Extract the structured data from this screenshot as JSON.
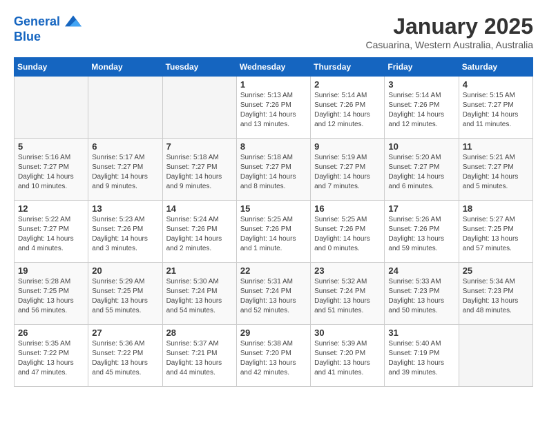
{
  "header": {
    "logo_line1": "General",
    "logo_line2": "Blue",
    "month_title": "January 2025",
    "location": "Casuarina, Western Australia, Australia"
  },
  "days_of_week": [
    "Sunday",
    "Monday",
    "Tuesday",
    "Wednesday",
    "Thursday",
    "Friday",
    "Saturday"
  ],
  "weeks": [
    {
      "days": [
        {
          "num": "",
          "sunrise": "",
          "sunset": "",
          "daylight": ""
        },
        {
          "num": "",
          "sunrise": "",
          "sunset": "",
          "daylight": ""
        },
        {
          "num": "",
          "sunrise": "",
          "sunset": "",
          "daylight": ""
        },
        {
          "num": "1",
          "sunrise": "Sunrise: 5:13 AM",
          "sunset": "Sunset: 7:26 PM",
          "daylight": "Daylight: 14 hours and 13 minutes."
        },
        {
          "num": "2",
          "sunrise": "Sunrise: 5:14 AM",
          "sunset": "Sunset: 7:26 PM",
          "daylight": "Daylight: 14 hours and 12 minutes."
        },
        {
          "num": "3",
          "sunrise": "Sunrise: 5:14 AM",
          "sunset": "Sunset: 7:26 PM",
          "daylight": "Daylight: 14 hours and 12 minutes."
        },
        {
          "num": "4",
          "sunrise": "Sunrise: 5:15 AM",
          "sunset": "Sunset: 7:27 PM",
          "daylight": "Daylight: 14 hours and 11 minutes."
        }
      ]
    },
    {
      "days": [
        {
          "num": "5",
          "sunrise": "Sunrise: 5:16 AM",
          "sunset": "Sunset: 7:27 PM",
          "daylight": "Daylight: 14 hours and 10 minutes."
        },
        {
          "num": "6",
          "sunrise": "Sunrise: 5:17 AM",
          "sunset": "Sunset: 7:27 PM",
          "daylight": "Daylight: 14 hours and 9 minutes."
        },
        {
          "num": "7",
          "sunrise": "Sunrise: 5:18 AM",
          "sunset": "Sunset: 7:27 PM",
          "daylight": "Daylight: 14 hours and 9 minutes."
        },
        {
          "num": "8",
          "sunrise": "Sunrise: 5:18 AM",
          "sunset": "Sunset: 7:27 PM",
          "daylight": "Daylight: 14 hours and 8 minutes."
        },
        {
          "num": "9",
          "sunrise": "Sunrise: 5:19 AM",
          "sunset": "Sunset: 7:27 PM",
          "daylight": "Daylight: 14 hours and 7 minutes."
        },
        {
          "num": "10",
          "sunrise": "Sunrise: 5:20 AM",
          "sunset": "Sunset: 7:27 PM",
          "daylight": "Daylight: 14 hours and 6 minutes."
        },
        {
          "num": "11",
          "sunrise": "Sunrise: 5:21 AM",
          "sunset": "Sunset: 7:27 PM",
          "daylight": "Daylight: 14 hours and 5 minutes."
        }
      ]
    },
    {
      "days": [
        {
          "num": "12",
          "sunrise": "Sunrise: 5:22 AM",
          "sunset": "Sunset: 7:27 PM",
          "daylight": "Daylight: 14 hours and 4 minutes."
        },
        {
          "num": "13",
          "sunrise": "Sunrise: 5:23 AM",
          "sunset": "Sunset: 7:26 PM",
          "daylight": "Daylight: 14 hours and 3 minutes."
        },
        {
          "num": "14",
          "sunrise": "Sunrise: 5:24 AM",
          "sunset": "Sunset: 7:26 PM",
          "daylight": "Daylight: 14 hours and 2 minutes."
        },
        {
          "num": "15",
          "sunrise": "Sunrise: 5:25 AM",
          "sunset": "Sunset: 7:26 PM",
          "daylight": "Daylight: 14 hours and 1 minute."
        },
        {
          "num": "16",
          "sunrise": "Sunrise: 5:25 AM",
          "sunset": "Sunset: 7:26 PM",
          "daylight": "Daylight: 14 hours and 0 minutes."
        },
        {
          "num": "17",
          "sunrise": "Sunrise: 5:26 AM",
          "sunset": "Sunset: 7:26 PM",
          "daylight": "Daylight: 13 hours and 59 minutes."
        },
        {
          "num": "18",
          "sunrise": "Sunrise: 5:27 AM",
          "sunset": "Sunset: 7:25 PM",
          "daylight": "Daylight: 13 hours and 57 minutes."
        }
      ]
    },
    {
      "days": [
        {
          "num": "19",
          "sunrise": "Sunrise: 5:28 AM",
          "sunset": "Sunset: 7:25 PM",
          "daylight": "Daylight: 13 hours and 56 minutes."
        },
        {
          "num": "20",
          "sunrise": "Sunrise: 5:29 AM",
          "sunset": "Sunset: 7:25 PM",
          "daylight": "Daylight: 13 hours and 55 minutes."
        },
        {
          "num": "21",
          "sunrise": "Sunrise: 5:30 AM",
          "sunset": "Sunset: 7:24 PM",
          "daylight": "Daylight: 13 hours and 54 minutes."
        },
        {
          "num": "22",
          "sunrise": "Sunrise: 5:31 AM",
          "sunset": "Sunset: 7:24 PM",
          "daylight": "Daylight: 13 hours and 52 minutes."
        },
        {
          "num": "23",
          "sunrise": "Sunrise: 5:32 AM",
          "sunset": "Sunset: 7:24 PM",
          "daylight": "Daylight: 13 hours and 51 minutes."
        },
        {
          "num": "24",
          "sunrise": "Sunrise: 5:33 AM",
          "sunset": "Sunset: 7:23 PM",
          "daylight": "Daylight: 13 hours and 50 minutes."
        },
        {
          "num": "25",
          "sunrise": "Sunrise: 5:34 AM",
          "sunset": "Sunset: 7:23 PM",
          "daylight": "Daylight: 13 hours and 48 minutes."
        }
      ]
    },
    {
      "days": [
        {
          "num": "26",
          "sunrise": "Sunrise: 5:35 AM",
          "sunset": "Sunset: 7:22 PM",
          "daylight": "Daylight: 13 hours and 47 minutes."
        },
        {
          "num": "27",
          "sunrise": "Sunrise: 5:36 AM",
          "sunset": "Sunset: 7:22 PM",
          "daylight": "Daylight: 13 hours and 45 minutes."
        },
        {
          "num": "28",
          "sunrise": "Sunrise: 5:37 AM",
          "sunset": "Sunset: 7:21 PM",
          "daylight": "Daylight: 13 hours and 44 minutes."
        },
        {
          "num": "29",
          "sunrise": "Sunrise: 5:38 AM",
          "sunset": "Sunset: 7:20 PM",
          "daylight": "Daylight: 13 hours and 42 minutes."
        },
        {
          "num": "30",
          "sunrise": "Sunrise: 5:39 AM",
          "sunset": "Sunset: 7:20 PM",
          "daylight": "Daylight: 13 hours and 41 minutes."
        },
        {
          "num": "31",
          "sunrise": "Sunrise: 5:40 AM",
          "sunset": "Sunset: 7:19 PM",
          "daylight": "Daylight: 13 hours and 39 minutes."
        },
        {
          "num": "",
          "sunrise": "",
          "sunset": "",
          "daylight": ""
        }
      ]
    }
  ]
}
